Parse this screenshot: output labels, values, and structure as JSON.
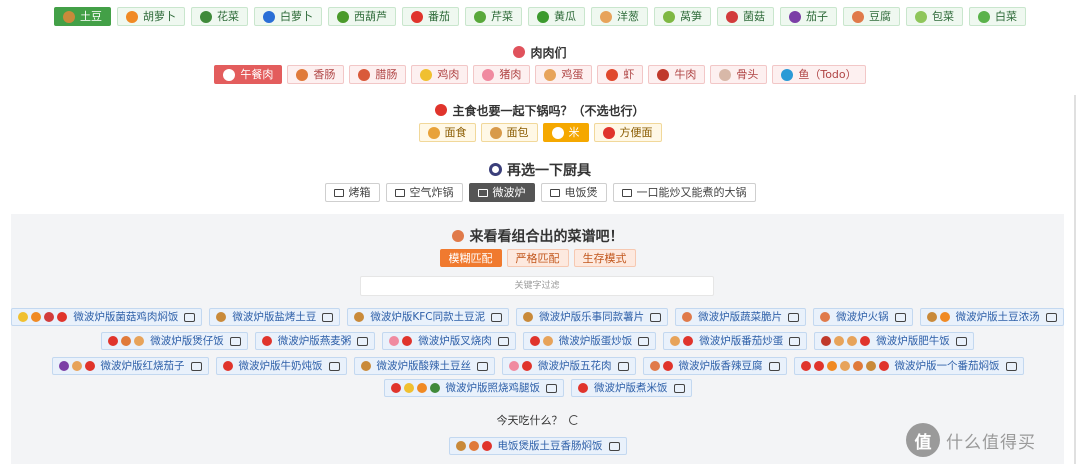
{
  "vegetables": [
    {
      "label": "土豆",
      "icon": "potato-icon",
      "color": "#c98a3a",
      "active": true
    },
    {
      "label": "胡萝卜",
      "icon": "carrot-icon",
      "color": "#f08a24",
      "active": false
    },
    {
      "label": "花菜",
      "icon": "cauliflower-icon",
      "color": "#3f8a3a",
      "active": false
    },
    {
      "label": "白萝卜",
      "icon": "radish-icon",
      "color": "#2a6fd6",
      "active": false
    },
    {
      "label": "西葫芦",
      "icon": "zucchini-icon",
      "color": "#4a9a2a",
      "active": false
    },
    {
      "label": "番茄",
      "icon": "tomato-icon",
      "color": "#e0342c",
      "active": false
    },
    {
      "label": "芹菜",
      "icon": "celery-icon",
      "color": "#58a83a",
      "active": false
    },
    {
      "label": "黄瓜",
      "icon": "cucumber-icon",
      "color": "#3c9a2e",
      "active": false
    },
    {
      "label": "洋葱",
      "icon": "onion-icon",
      "color": "#e7a35a",
      "active": false
    },
    {
      "label": "莴笋",
      "icon": "lettuce-stem-icon",
      "color": "#7fb843",
      "active": false
    },
    {
      "label": "菌菇",
      "icon": "mushroom-icon",
      "color": "#d23c3c",
      "active": false
    },
    {
      "label": "茄子",
      "icon": "eggplant-icon",
      "color": "#7b3fa6",
      "active": false
    },
    {
      "label": "豆腐",
      "icon": "tofu-icon",
      "color": "#e07a4a",
      "active": false
    },
    {
      "label": "包菜",
      "icon": "cabbage-icon",
      "color": "#8fc65a",
      "active": false
    },
    {
      "label": "白菜",
      "icon": "bok-choy-icon",
      "color": "#5ab24a",
      "active": false
    }
  ],
  "meat": {
    "title": "肉肉们",
    "title_icon_color": "#e0525c",
    "items": [
      {
        "label": "午餐肉",
        "icon": "luncheon-meat-icon",
        "color": "#ffffff",
        "active": true
      },
      {
        "label": "香肠",
        "icon": "sausage-icon",
        "color": "#e07a3a",
        "active": false
      },
      {
        "label": "腊肠",
        "icon": "chinese-sausage-icon",
        "color": "#d95a3a",
        "active": false
      },
      {
        "label": "鸡肉",
        "icon": "chicken-icon",
        "color": "#f0c030",
        "active": false
      },
      {
        "label": "猪肉",
        "icon": "pork-icon",
        "color": "#f08aa0",
        "active": false
      },
      {
        "label": "鸡蛋",
        "icon": "egg-icon",
        "color": "#e7a35a",
        "active": false
      },
      {
        "label": "虾",
        "icon": "shrimp-icon",
        "color": "#e0482c",
        "active": false
      },
      {
        "label": "牛肉",
        "icon": "beef-icon",
        "color": "#c0392b",
        "active": false
      },
      {
        "label": "骨头",
        "icon": "bone-icon",
        "color": "#d8b8a8",
        "active": false
      },
      {
        "label": "鱼（Todo）",
        "icon": "fish-icon",
        "color": "#2a9ad6",
        "active": false
      }
    ]
  },
  "staple": {
    "title": "主食也要一起下锅吗？（不选也行）",
    "title_icon_color": "#e0342c",
    "items": [
      {
        "label": "面食",
        "icon": "noodles-icon",
        "color": "#e8a23a",
        "active": false
      },
      {
        "label": "面包",
        "icon": "bread-icon",
        "color": "#d89a4a",
        "active": false
      },
      {
        "label": "米",
        "icon": "rice-icon",
        "color": "#ffffff",
        "active": true
      },
      {
        "label": "方便面",
        "icon": "instant-noodles-icon",
        "color": "#e0342c",
        "active": false
      }
    ]
  },
  "tools": {
    "title": "再选一下厨具",
    "items": [
      {
        "label": "烤箱",
        "icon": "oven-icon",
        "active": false
      },
      {
        "label": "空气炸锅",
        "icon": "air-fryer-icon",
        "active": false
      },
      {
        "label": "微波炉",
        "icon": "microwave-icon",
        "active": true
      },
      {
        "label": "电饭煲",
        "icon": "rice-cooker-icon",
        "active": false
      },
      {
        "label": "一口能炒又能煮的大锅",
        "icon": "wok-icon",
        "active": false
      }
    ]
  },
  "results": {
    "title": "来看看组合出的菜谱吧！",
    "modes": [
      {
        "label": "模糊匹配",
        "active": true
      },
      {
        "label": "严格匹配",
        "active": false
      },
      {
        "label": "生存模式",
        "active": false
      }
    ],
    "filter_placeholder": "关键字过滤",
    "rows": [
      [
        {
          "title": "微波炉版菌菇鸡肉焖饭",
          "icons": [
            "#f0c030",
            "#f08a24",
            "#d23c3c",
            "#e0342c"
          ]
        },
        {
          "title": "微波炉版盐烤土豆",
          "icons": [
            "#c98a3a"
          ]
        },
        {
          "title": "微波炉版KFC同款土豆泥",
          "icons": [
            "#c98a3a"
          ]
        },
        {
          "title": "微波炉版乐事同款薯片",
          "icons": [
            "#c98a3a"
          ]
        },
        {
          "title": "微波炉版蔬菜脆片",
          "icons": [
            "#e07a4a"
          ]
        },
        {
          "title": "微波炉火锅",
          "icons": [
            "#e07a4a"
          ]
        },
        {
          "title": "微波炉版土豆浓汤",
          "icons": [
            "#c98a3a",
            "#f08a24"
          ]
        }
      ],
      [
        {
          "title": "微波炉版煲仔饭",
          "icons": [
            "#e0342c",
            "#e07a3a",
            "#e7a35a"
          ]
        },
        {
          "title": "微波炉版燕麦粥",
          "icons": [
            "#e0342c"
          ]
        },
        {
          "title": "微波炉版叉烧肉",
          "icons": [
            "#f08aa0",
            "#e0342c"
          ]
        },
        {
          "title": "微波炉版蛋炒饭",
          "icons": [
            "#e0342c",
            "#e7a35a"
          ]
        },
        {
          "title": "微波炉版番茄炒蛋",
          "icons": [
            "#e7a35a",
            "#e0342c"
          ]
        },
        {
          "title": "微波炉版肥牛饭",
          "icons": [
            "#c0392b",
            "#e7a35a",
            "#e7a35a",
            "#e0342c"
          ]
        }
      ],
      [
        {
          "title": "微波炉版红烧茄子",
          "icons": [
            "#7b3fa6",
            "#e7a35a",
            "#e0342c"
          ]
        },
        {
          "title": "微波炉版牛奶炖饭",
          "icons": [
            "#e0342c"
          ]
        },
        {
          "title": "微波炉版酸辣土豆丝",
          "icons": [
            "#c98a3a"
          ]
        },
        {
          "title": "微波炉版五花肉",
          "icons": [
            "#f08aa0",
            "#e0342c"
          ]
        },
        {
          "title": "微波炉版香辣豆腐",
          "icons": [
            "#e07a4a",
            "#e0342c"
          ]
        },
        {
          "title": "微波炉版一个番茄焖饭",
          "icons": [
            "#e0342c",
            "#e0342c",
            "#f08a24",
            "#e7a35a",
            "#e07a3a",
            "#c98a3a",
            "#e0342c"
          ]
        }
      ],
      [
        {
          "title": "微波炉版照烧鸡腿饭",
          "icons": [
            "#e0342c",
            "#f0c030",
            "#f08a24",
            "#3f8a3a"
          ]
        },
        {
          "title": "微波炉版煮米饭",
          "icons": [
            "#e0342c"
          ]
        }
      ]
    ],
    "today_label": "今天吃什么？",
    "today_item": {
      "title": "电饭煲版土豆香肠焖饭",
      "icons": [
        "#c98a3a",
        "#e07a3a",
        "#e0342c"
      ]
    }
  },
  "watermark": {
    "logo": "值",
    "text": "什么值得买"
  }
}
